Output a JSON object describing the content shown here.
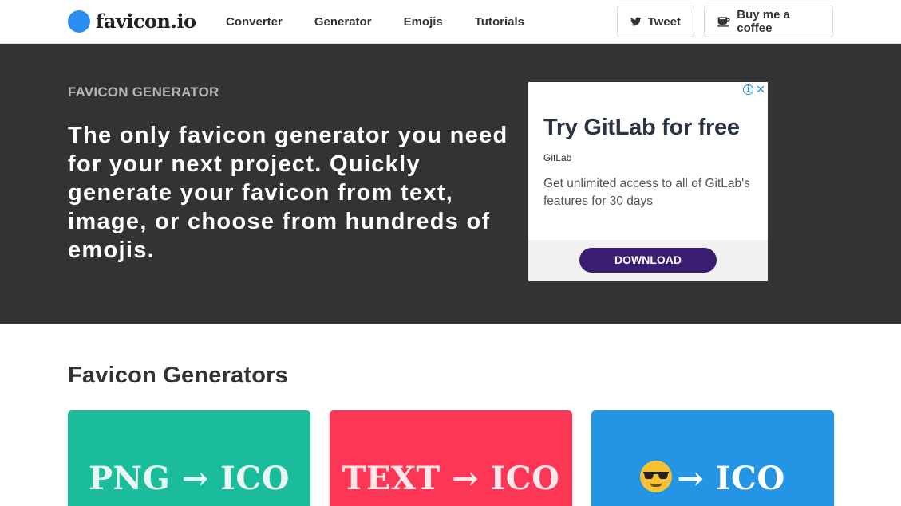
{
  "header": {
    "logo_text": "favicon.io",
    "nav_items": [
      {
        "label": "Converter"
      },
      {
        "label": "Generator"
      },
      {
        "label": "Emojis"
      },
      {
        "label": "Tutorials"
      }
    ],
    "tweet_label": "Tweet",
    "coffee_label": "Buy me a coffee"
  },
  "hero": {
    "kicker": "FAVICON GENERATOR",
    "title": "The only favicon generator you need for your next project. Quickly generate your favicon from text, image, or choose from hundreds of emojis."
  },
  "ad": {
    "headline": "Try GitLab for free",
    "brand": "GitLab",
    "description": "Get unlimited access to all of GitLab's features for 30 days",
    "cta": "DOWNLOAD",
    "info_icon": "info-icon",
    "close_icon": "close-icon"
  },
  "generators": {
    "title": "Favicon Generators",
    "cards": [
      {
        "label": "PNG → ICO",
        "color": "#1abc9c"
      },
      {
        "label": "TEXT → ICO",
        "color": "#fc3655"
      },
      {
        "label": "→ ICO",
        "emoji": "sunglasses-emoji",
        "color": "#2494e4"
      }
    ]
  },
  "colors": {
    "logo_dot": "#2b8ef3",
    "hero_bg": "#333333",
    "ad_cta": "#3a1c71"
  }
}
